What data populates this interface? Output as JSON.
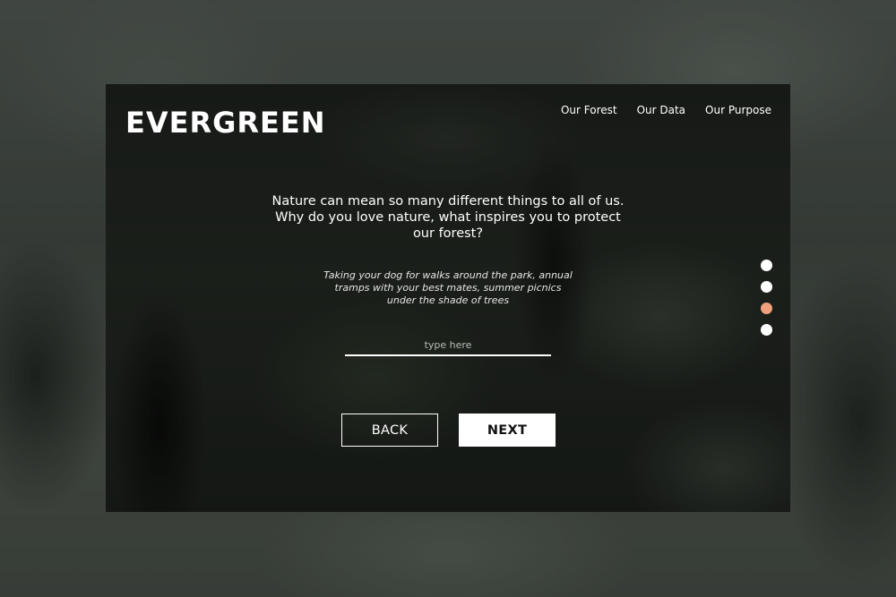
{
  "brand": {
    "name": "EVERGREEN"
  },
  "nav": {
    "items": [
      {
        "label": "Our Forest"
      },
      {
        "label": "Our Data"
      },
      {
        "label": "Our Purpose"
      }
    ]
  },
  "question": {
    "line1": "Nature can mean so many different things to all of us.",
    "line2": "Why do you love nature, what inspires you to protect",
    "line3": "our forest?"
  },
  "hint": {
    "line1": "Taking your dog for walks around the park, annual",
    "line2": "tramps with your best mates, summer picnics",
    "line3": "under the shade of trees"
  },
  "answer": {
    "value": "",
    "placeholder": "type here"
  },
  "buttons": {
    "back_label": "BACK",
    "next_label": "NEXT"
  },
  "pager": {
    "total": 4,
    "active_index": 2,
    "active_color": "#f0a07a",
    "inactive_color": "#ffffff"
  }
}
